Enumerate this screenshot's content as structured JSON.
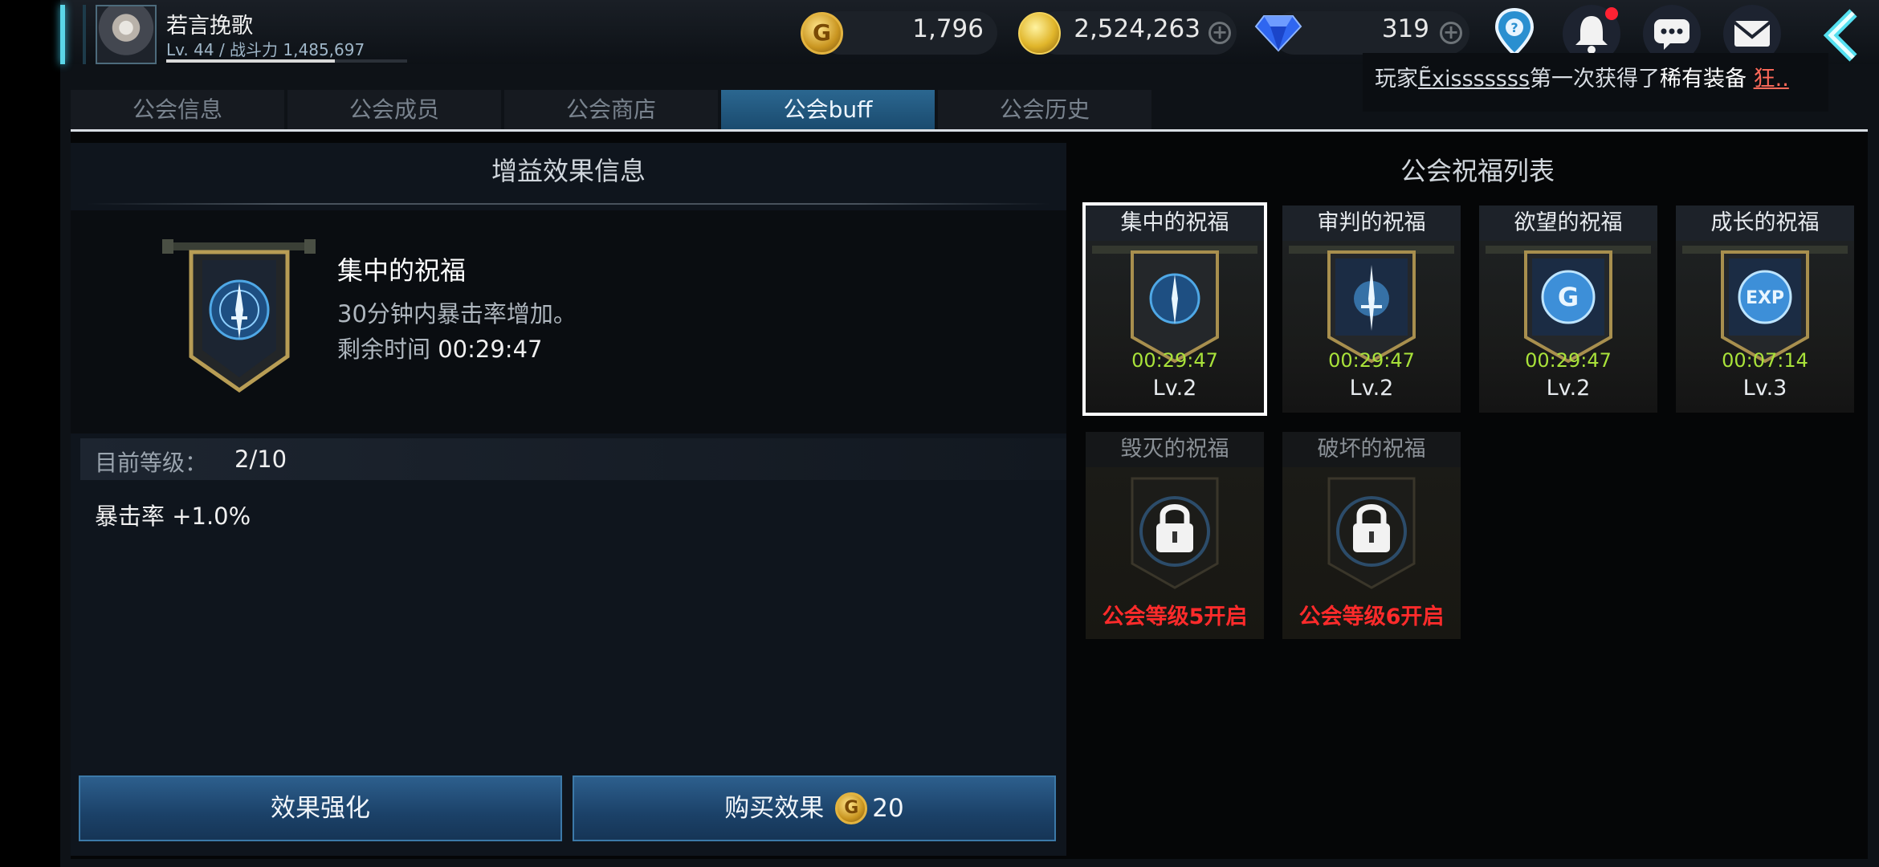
{
  "player": {
    "name": "若言挽歌",
    "level": "Lv. 44",
    "power_label": "战斗力",
    "power": "1,485,697"
  },
  "currency": {
    "guild_coin": "1,796",
    "guild_coin_icon": "G",
    "gold": "2,524,263",
    "diamond": "319"
  },
  "notice": {
    "prefix": "玩家",
    "player": "Ẽxisssssss",
    "middle": "第一次获得了",
    "item": "稀有装备",
    "suffix": "狂.."
  },
  "tabs": [
    {
      "label": "公会信息"
    },
    {
      "label": "公会成员"
    },
    {
      "label": "公会商店"
    },
    {
      "label": "公会buff"
    },
    {
      "label": "公会历史"
    }
  ],
  "detail": {
    "title": "增益效果信息",
    "name": "集中的祝福",
    "description": "30分钟内暴击率增加。",
    "time_label": "剩余时间",
    "time": "00:29:47",
    "level_label": "目前等级：",
    "level": "2/10",
    "effect": "暴击率 +1.0%"
  },
  "buttons": {
    "enhance": "效果强化",
    "buy": "购买效果",
    "buy_cost_icon": "G",
    "buy_cost": "20"
  },
  "blessings": {
    "title": "公会祝福列表",
    "items": [
      {
        "name": "集中的祝福",
        "time": "00:29:47",
        "level": "Lv.2",
        "icon": "dagger-icon"
      },
      {
        "name": "审判的祝福",
        "time": "00:29:47",
        "level": "Lv.2",
        "icon": "sword-burst-icon"
      },
      {
        "name": "欲望的祝福",
        "time": "00:29:47",
        "level": "Lv.2",
        "icon": "gold-coin-icon",
        "glyph": "G"
      },
      {
        "name": "成长的祝福",
        "time": "00:07:14",
        "level": "Lv.3",
        "icon": "exp-icon",
        "glyph": "EXP"
      },
      {
        "name": "毁灭的祝福",
        "lock_text": "公会等级5开启",
        "icon": "lock-icon"
      },
      {
        "name": "破坏的祝福",
        "lock_text": "公会等级6开启",
        "icon": "lock-icon"
      }
    ]
  },
  "colors": {
    "accent": "#2b6790",
    "timer": "#a9e23a",
    "locked": "#ff2b2b",
    "notification_dot": "#ff2233"
  }
}
